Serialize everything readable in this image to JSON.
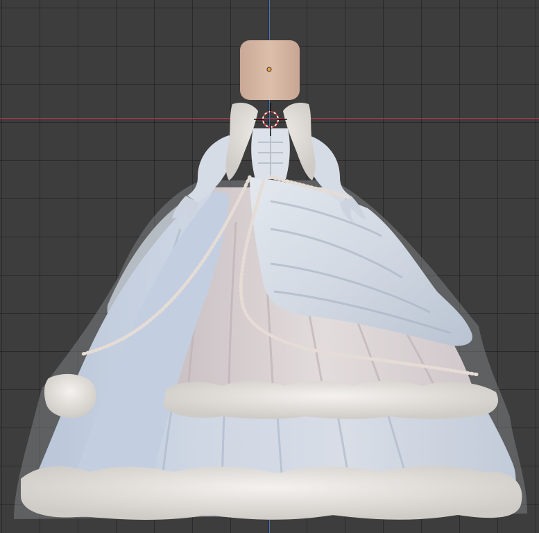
{
  "viewport": {
    "background": "#3d3d3d",
    "grid_color": "#1f1f1f",
    "x_axis_color": "#b83a4a",
    "y_axis_color": "#4a76b8"
  },
  "model": {
    "head_color": "#d4b5a0",
    "dress_color": "#d9dfe8",
    "fur_color": "#e8e6e3",
    "pearl_color": "#e8ddd6"
  },
  "icons": [
    "origin-dot-icon",
    "3d-cursor-icon"
  ]
}
